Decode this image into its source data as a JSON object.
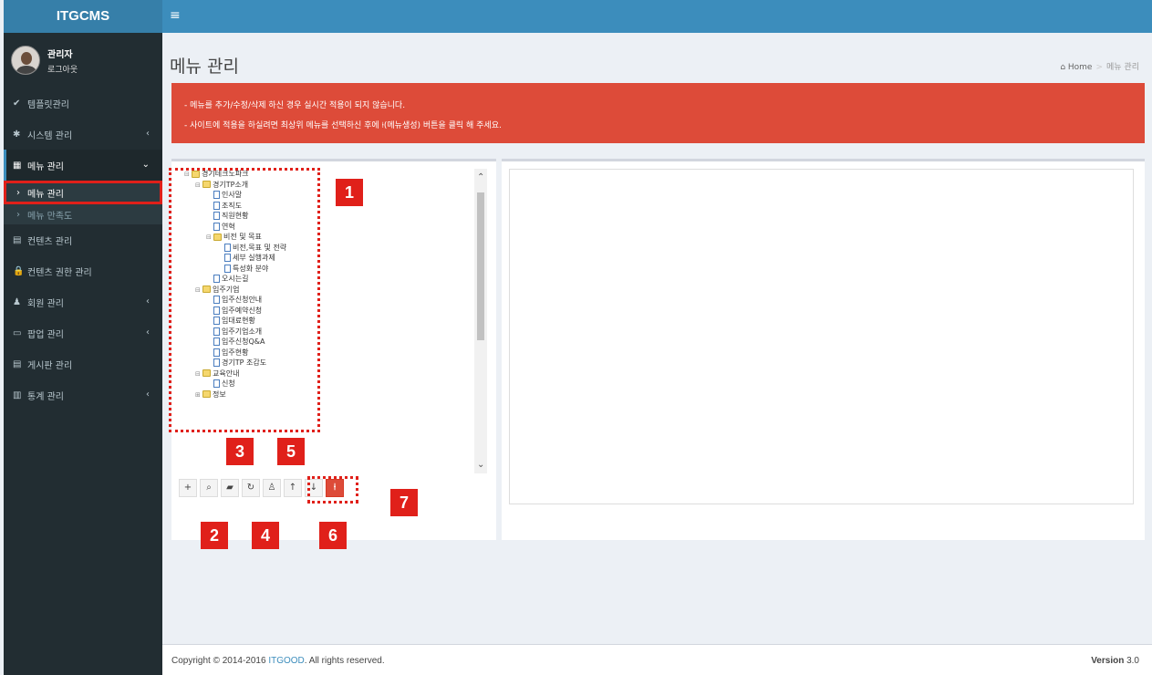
{
  "app": {
    "logo": "ITGCMS"
  },
  "user": {
    "name": "관리자",
    "logout": "로그아웃"
  },
  "sidebar": {
    "items": [
      {
        "icon": "✔",
        "label": "템플릿관리",
        "caret": ""
      },
      {
        "icon": "✱",
        "label": "시스템 관리",
        "caret": "‹"
      },
      {
        "icon": "▦",
        "label": "메뉴 관리",
        "caret": "⌄"
      },
      {
        "icon": "▤",
        "label": "컨텐츠 관리",
        "caret": ""
      },
      {
        "icon": "🔒",
        "label": "컨텐츠 권한 관리",
        "caret": ""
      },
      {
        "icon": "♟",
        "label": "회원 관리",
        "caret": "‹"
      },
      {
        "icon": "▭",
        "label": "팝업 관리",
        "caret": "‹"
      },
      {
        "icon": "▤",
        "label": "게시판 관리",
        "caret": ""
      },
      {
        "icon": "▥",
        "label": "통계 관리",
        "caret": "‹"
      }
    ],
    "sub_items": [
      {
        "chev": "›",
        "label": "메뉴 관리"
      },
      {
        "chev": "›",
        "label": "메뉴 만족도"
      }
    ]
  },
  "header": {
    "menu_toggle": "≡"
  },
  "page": {
    "title": "메뉴 관리",
    "breadcrumb_home": "Home",
    "breadcrumb_current": "메뉴 관리"
  },
  "alert": {
    "line1": "- 메뉴를 추가/수정/삭제 하신 경우 실시간 적용이 되지 않습니다.",
    "line2": "- 사이트에 적용을 하실려면 최상위 메뉴를 선택하신 후에 ⍿(메뉴생성) 버튼을 클릭 해 주세요."
  },
  "tree": [
    {
      "depth": 0,
      "type": "folder",
      "exp": "⊟",
      "label": "경기테크노파크"
    },
    {
      "depth": 1,
      "type": "folder",
      "exp": "⊟",
      "label": "경기TP소개"
    },
    {
      "depth": 2,
      "type": "doc",
      "exp": "",
      "label": "인사말"
    },
    {
      "depth": 2,
      "type": "doc",
      "exp": "",
      "label": "조직도"
    },
    {
      "depth": 2,
      "type": "doc",
      "exp": "",
      "label": "직원현황"
    },
    {
      "depth": 2,
      "type": "doc",
      "exp": "",
      "label": "연혁"
    },
    {
      "depth": 2,
      "type": "folder",
      "exp": "⊟",
      "label": "비전 및 목표"
    },
    {
      "depth": 3,
      "type": "doc",
      "exp": "",
      "label": "비전,목표 및 전략"
    },
    {
      "depth": 3,
      "type": "doc",
      "exp": "",
      "label": "세부 실행과제"
    },
    {
      "depth": 3,
      "type": "doc",
      "exp": "",
      "label": "특성화 분야"
    },
    {
      "depth": 2,
      "type": "doc",
      "exp": "",
      "label": "오시는길"
    },
    {
      "depth": 1,
      "type": "folder",
      "exp": "⊟",
      "label": "입주기업"
    },
    {
      "depth": 2,
      "type": "doc",
      "exp": "",
      "label": "입주신청안내"
    },
    {
      "depth": 2,
      "type": "doc",
      "exp": "",
      "label": "입주예약신청"
    },
    {
      "depth": 2,
      "type": "doc",
      "exp": "",
      "label": "임대료현황"
    },
    {
      "depth": 2,
      "type": "doc",
      "exp": "",
      "label": "입주기업소개"
    },
    {
      "depth": 2,
      "type": "doc",
      "exp": "",
      "label": "입주신청Q&A"
    },
    {
      "depth": 2,
      "type": "doc",
      "exp": "",
      "label": "입주현황"
    },
    {
      "depth": 2,
      "type": "doc",
      "exp": "",
      "label": "경기TP 조감도"
    },
    {
      "depth": 1,
      "type": "folder",
      "exp": "⊟",
      "label": "교육안내"
    },
    {
      "depth": 2,
      "type": "doc",
      "exp": "",
      "label": "신청"
    },
    {
      "depth": 1,
      "type": "folder",
      "exp": "⊞",
      "label": "정보"
    }
  ],
  "toolbar": {
    "buttons": [
      {
        "name": "add-button",
        "glyph": "+"
      },
      {
        "name": "search-button",
        "glyph": "⌕"
      },
      {
        "name": "open-folder-button",
        "glyph": "▰"
      },
      {
        "name": "refresh-button",
        "glyph": "↻"
      },
      {
        "name": "user-button",
        "glyph": "♙"
      },
      {
        "name": "move-up-button",
        "glyph": "↑"
      },
      {
        "name": "move-down-button",
        "glyph": "↓"
      },
      {
        "name": "generate-menu-button",
        "glyph": "⍿"
      }
    ]
  },
  "annotations": [
    "1",
    "2",
    "3",
    "4",
    "5",
    "6",
    "7"
  ],
  "footer": {
    "copy_prefix": "Copyright © 2014-2016 ",
    "copy_link": "ITGOOD",
    "copy_suffix": ". All rights reserved.",
    "version_label": "Version ",
    "version_number": "3.0"
  }
}
